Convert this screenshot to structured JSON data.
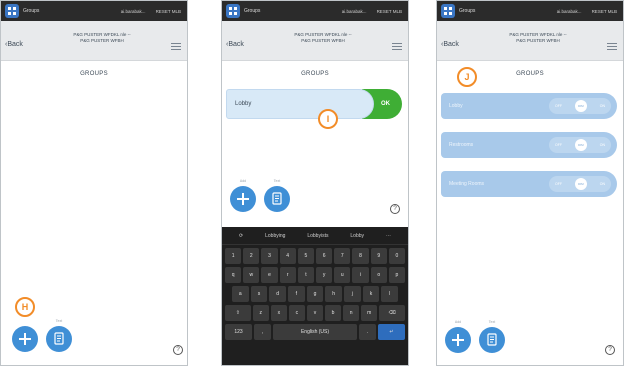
{
  "statusbar": {
    "app_title": "Groups",
    "user": "ai.barabak...",
    "reset": "RESET MLB"
  },
  "navbar": {
    "back_label": "Back",
    "title_line1": "P&G PUSTER WFDKL nle --",
    "title_line2": "P&G PUSTER WFBH"
  },
  "section_title": "GROUPS",
  "fab": {
    "add_caption": "Add",
    "text_caption": "Text"
  },
  "callouts": {
    "h": "H",
    "i": "I",
    "j": "J"
  },
  "input": {
    "value": "Lobby",
    "ok_label": "OK"
  },
  "keyboard": {
    "suggestions": [
      "Lobbying",
      "Lobbyists",
      "Lobby"
    ],
    "row1": [
      "1",
      "2",
      "3",
      "4",
      "5",
      "6",
      "7",
      "8",
      "9",
      "0"
    ],
    "row2": [
      "q",
      "w",
      "e",
      "r",
      "t",
      "y",
      "u",
      "i",
      "o",
      "p"
    ],
    "row3": [
      "a",
      "s",
      "d",
      "f",
      "g",
      "h",
      "j",
      "k",
      "l"
    ],
    "row4": [
      "z",
      "x",
      "c",
      "v",
      "b",
      "n",
      "m"
    ],
    "row5_left": "123",
    "row5_space": "English (US)",
    "row5_right": "."
  },
  "groups": [
    {
      "name": "Lobby",
      "left": "OFF",
      "mid": "DIM",
      "right": "ON"
    },
    {
      "name": "Restrooms",
      "left": "OFF",
      "mid": "DIM",
      "right": "ON"
    },
    {
      "name": "Meeting Rooms",
      "left": "OFF",
      "mid": "DIM",
      "right": "ON"
    }
  ],
  "help_glyph": "?",
  "colors": {
    "statusbar": "#2b2b2b",
    "accent_blue": "#3f8fd6",
    "ok_green": "#3fae35",
    "callout_orange": "#f28c28",
    "group_row": "#a8c9ea"
  }
}
